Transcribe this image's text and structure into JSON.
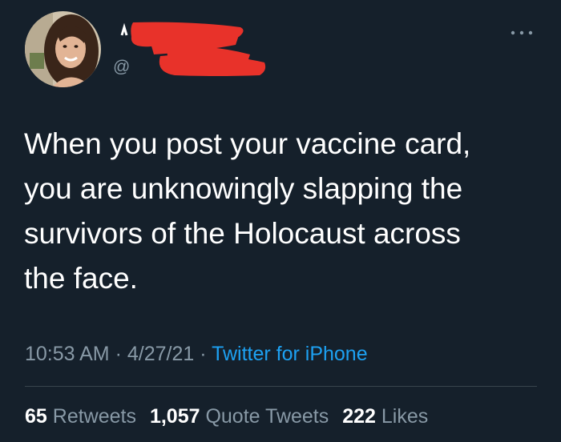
{
  "tweet": {
    "handle": "@",
    "text_lines": [
      "When you post your vaccine card,",
      "you are unknowingly slapping the",
      "survivors of the Holocaust across",
      "the face."
    ],
    "time": "10:53 AM",
    "date": "4/27/21",
    "source": "Twitter for iPhone",
    "separator": "·"
  },
  "stats": {
    "retweets_count": "65",
    "retweets_label": "Retweets",
    "quote_tweets_count": "1,057",
    "quote_tweets_label": "Quote Tweets",
    "likes_count": "222",
    "likes_label": "Likes"
  },
  "colors": {
    "background": "#15202b",
    "text": "#ffffff",
    "muted": "#8899a6",
    "link": "#1da1f2",
    "redaction": "#e8322a",
    "divider": "#38444d"
  },
  "icons": {
    "more": "more-horizontal-icon"
  }
}
